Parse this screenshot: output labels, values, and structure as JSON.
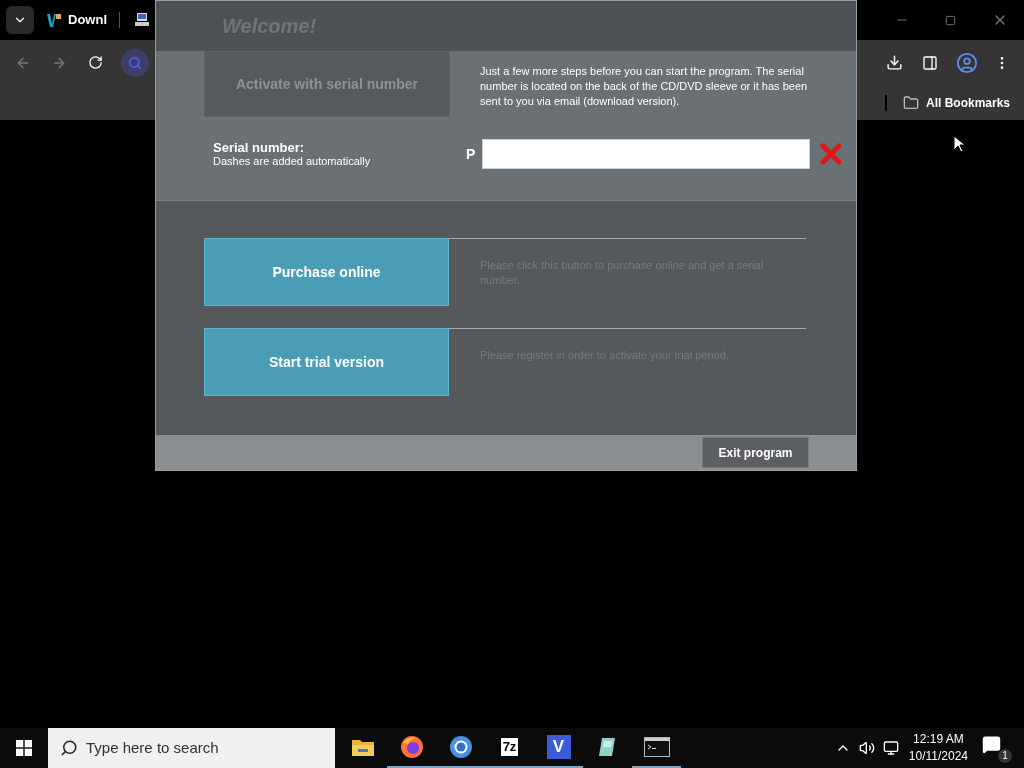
{
  "browser": {
    "tab_title": "Downl",
    "bookmarks_label": "All Bookmarks"
  },
  "dialog": {
    "title": "Welcome!",
    "activate_button": {
      "label": "Activate with serial number",
      "disabled": true
    },
    "intro": "Just a few more steps before you can start the program. The serial number is located on the back of the CD/DVD sleeve or it has been sent to you via email (download version).",
    "serial": {
      "label": "Serial number:",
      "hint": "Dashes are added automatically",
      "prefix": "P"
    },
    "options": [
      {
        "label": "Purchase online",
        "description": "Please click this button to purchase online and get a serial number."
      },
      {
        "label": "Start trial version",
        "description": "Please register in order to activate your trial period."
      }
    ],
    "exit_button": "Exit program"
  },
  "taskbar": {
    "search_placeholder": "Type here to search",
    "apps": [
      {
        "kind": "folder",
        "running": false
      },
      {
        "kind": "firefox",
        "running": true
      },
      {
        "kind": "chrome",
        "running": true
      },
      {
        "kind": "archive",
        "label": "7z",
        "running": true
      },
      {
        "kind": "letter",
        "label": "V",
        "running": true
      },
      {
        "kind": "notepad",
        "running": false
      },
      {
        "kind": "terminal",
        "running": true
      }
    ],
    "time": "12:19 AM",
    "date": "10/11/2024",
    "notification_count": "1"
  }
}
